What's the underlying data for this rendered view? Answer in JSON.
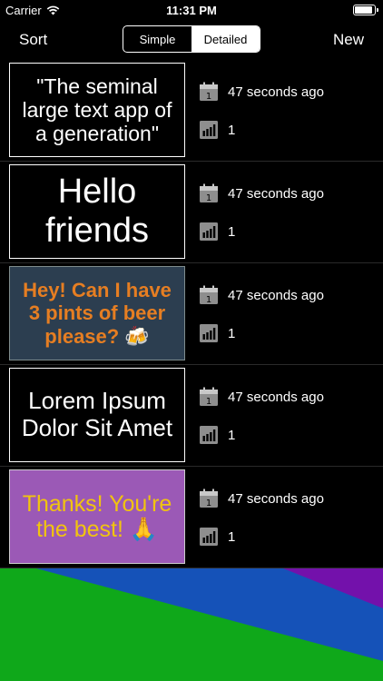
{
  "status": {
    "carrier": "Carrier",
    "time": "11:31 PM",
    "battery_level": 0.95
  },
  "nav": {
    "sort_label": "Sort",
    "new_label": "New",
    "segments": [
      {
        "label": "Simple",
        "selected": false
      },
      {
        "label": "Detailed",
        "selected": true
      }
    ]
  },
  "signs": [
    {
      "text": "\"The seminal large text app of a generation\"",
      "time_ago": "47 seconds ago",
      "views": "1",
      "bg": "#000000",
      "fg": "#ffffff",
      "border": "#ffffff",
      "font_size": 23,
      "bold": false
    },
    {
      "text": "Hello friends",
      "time_ago": "47 seconds ago",
      "views": "1",
      "bg": "#000000",
      "fg": "#ffffff",
      "border": "#ffffff",
      "font_size": 38,
      "bold": false
    },
    {
      "text": "Hey! Can I have 3 pints of beer please? 🍻",
      "time_ago": "47 seconds ago",
      "views": "1",
      "bg": "#2c3e50",
      "fg": "#e67e22",
      "border": "#7f8c8d",
      "font_size": 22,
      "bold": true
    },
    {
      "text": "Lorem Ipsum Dolor Sit Amet",
      "time_ago": "47 seconds ago",
      "views": "1",
      "bg": "#000000",
      "fg": "#ffffff",
      "border": "#ffffff",
      "font_size": 26,
      "bold": false
    },
    {
      "text": "Thanks! You're the best! 🙏",
      "time_ago": "47 seconds ago",
      "views": "1",
      "bg": "#9b59b6",
      "fg": "#f1c40f",
      "border": "#cccccc",
      "font_size": 25,
      "bold": false
    }
  ],
  "icons": {
    "date": "calendar-icon",
    "views": "bar-chart-icon",
    "wifi": "wifi-icon",
    "battery": "battery-icon"
  },
  "colors": {
    "bottom_green": "#0fa81a",
    "bottom_blue": "#1552b8",
    "bottom_purple": "#7311ab"
  }
}
